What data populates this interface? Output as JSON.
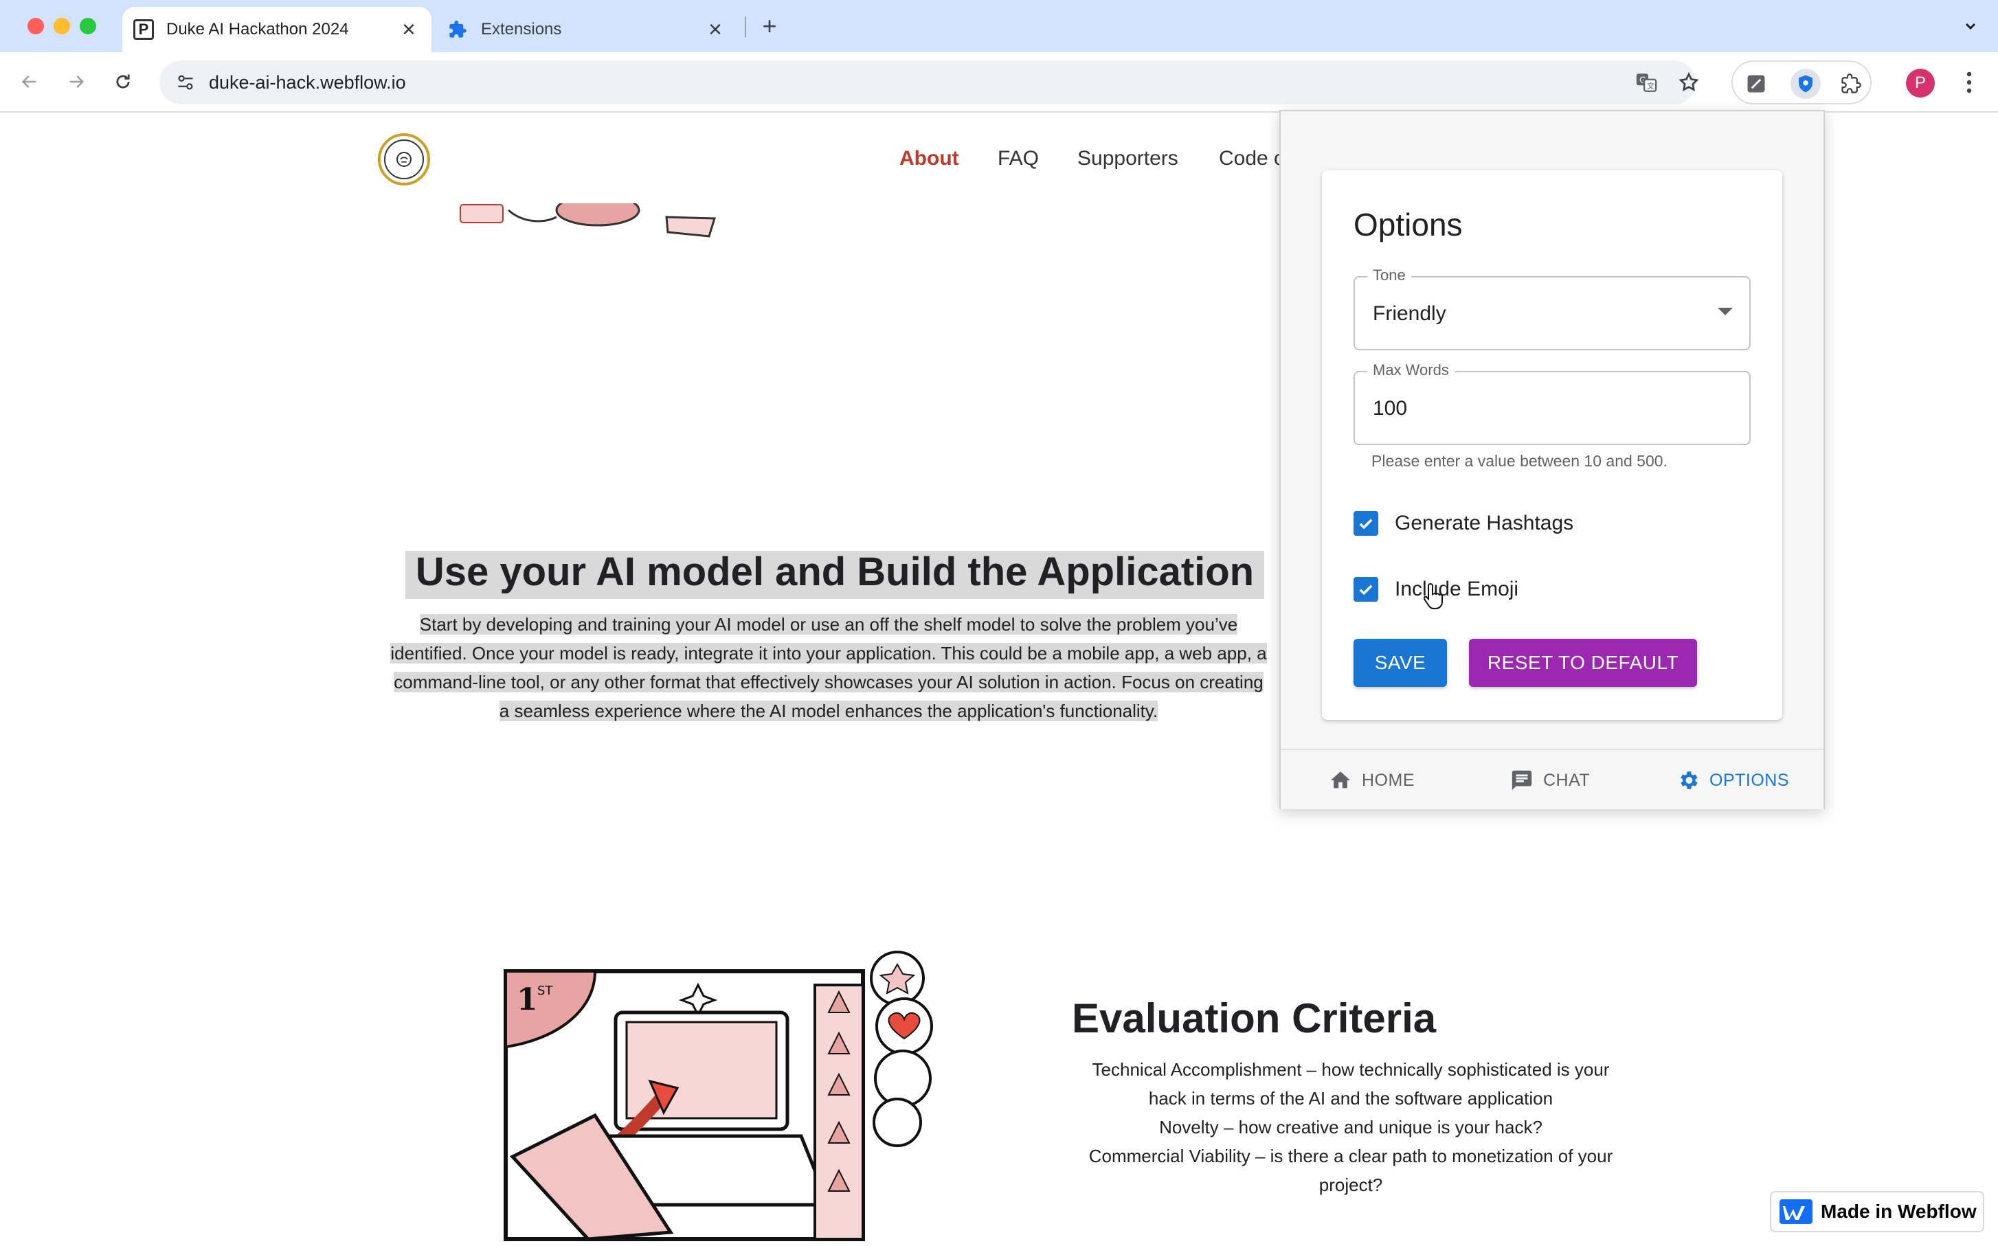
{
  "browser": {
    "tabs": [
      {
        "title": "Duke AI Hackathon 2024",
        "favicon": "P",
        "active": true
      },
      {
        "title": "Extensions",
        "favicon": "puzzle-icon",
        "active": false
      }
    ],
    "url": "duke-ai-hack.webflow.io",
    "profile_initial": "P",
    "accent": "#d3e3fd"
  },
  "site": {
    "nav": {
      "about": "About",
      "faq": "FAQ",
      "supporters": "Supporters",
      "code": "Code of Conduct"
    },
    "build_section": {
      "title": "Use your AI model and Build the Application",
      "paragraph_lines": [
        "Start by developing and training your AI model or use an off the shelf model to solve the problem you’ve",
        "identified. Once your model is ready, integrate it into your application. This could be a mobile app, a web app, a",
        "command-line tool, or any other format that effectively showcases your AI solution in action. Focus on creating",
        "a seamless experience where the AI model enhances the application's functionality."
      ]
    },
    "evaluation": {
      "title": "Evaluation Criteria",
      "lines": [
        "Technical Accomplishment – how technically sophisticated is your",
        "hack in terms of the AI and the software application",
        "Novelty – how creative and unique is your hack?",
        "Commercial Viability – is there a clear path to monetization of your",
        "project?"
      ]
    },
    "badge": "Made in Webflow",
    "active_nav_color": "#c0392b"
  },
  "popup": {
    "title": "Options",
    "tone": {
      "label": "Tone",
      "value": "Friendly"
    },
    "max_words": {
      "label": "Max Words",
      "value": "100",
      "helper": "Please enter a value between 10 and 500."
    },
    "checkboxes": [
      {
        "label": "Generate Hashtags",
        "checked": true
      },
      {
        "label": "Include Emoji",
        "checked": true
      }
    ],
    "buttons": {
      "save": "SAVE",
      "reset": "RESET TO DEFAULT"
    },
    "bottom_nav": [
      {
        "label": "HOME",
        "icon": "home-icon",
        "active": false
      },
      {
        "label": "CHAT",
        "icon": "chat-icon",
        "active": false
      },
      {
        "label": "OPTIONS",
        "icon": "gear-icon",
        "active": true
      }
    ],
    "colors": {
      "primary": "#1976d2",
      "secondary": "#9c27b0"
    }
  }
}
